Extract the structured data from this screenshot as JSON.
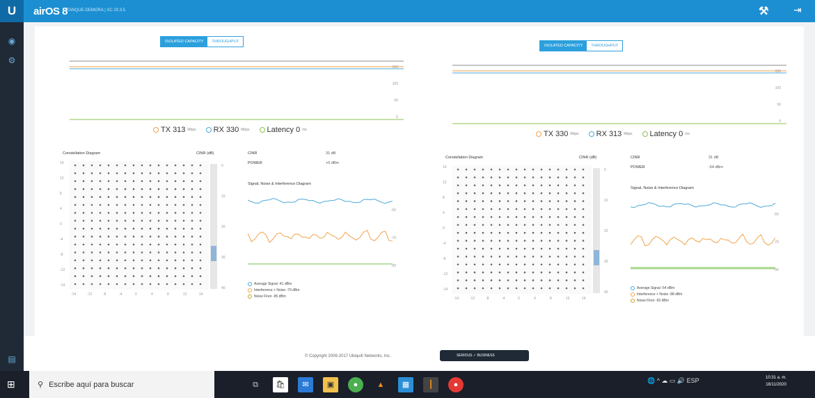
{
  "topbar": {
    "logo": "U",
    "product": "airOS 8",
    "device": "TANQUE-DEMORA | XC 20.3.5",
    "tool_icon": "antenna-tools-icon",
    "logout_icon": "logout-icon"
  },
  "sidebar": {
    "items": [
      {
        "name": "dashboard",
        "icon": "gauge-icon"
      },
      {
        "name": "settings",
        "icon": "gear-icon"
      },
      {
        "name": "logs",
        "icon": "log-icon"
      }
    ]
  },
  "panels": [
    {
      "tabs": [
        "ISOLATED CAPACITY",
        "THROUGHPUT"
      ],
      "active_tab": 0,
      "throughput_axis_right": [
        "200",
        "100",
        "50",
        "0"
      ],
      "legend": {
        "tx_label": "TX",
        "tx_value": "313",
        "tx_unit": "Mbps",
        "rx_label": "RX",
        "rx_value": "330",
        "rx_unit": "Mbps",
        "lat_label": "Latency",
        "lat_value": "0",
        "lat_unit": "ms"
      },
      "constellation_title": "Constellation Diagram",
      "cinr_label": "CINR (dB)",
      "y_ticks": [
        "14",
        "12",
        "8",
        "4",
        "0",
        "-4",
        "-8",
        "-12",
        "-14"
      ],
      "x_ticks": [
        "-14",
        "-12",
        "-8",
        "-4",
        "0",
        "4",
        "8",
        "12",
        "14"
      ],
      "scale_ticks": [
        "0",
        "10",
        "20",
        "30",
        "40"
      ],
      "stats": [
        {
          "label": "CINR",
          "value": "31 dB"
        },
        {
          "label": "POWER",
          "value": "+0 dBm"
        }
      ],
      "sni_title": "Signal, Noise & Interference Diagram",
      "sni_axis": [
        "-50",
        "-70",
        "-90"
      ],
      "sni_legend": [
        "Average Signal -41 dBm",
        "Interference + Noise -79 dBm",
        "Noise Floor -95 dBm"
      ]
    },
    {
      "tabs": [
        "ISOLATED CAPACITY",
        "THROUGHPUT"
      ],
      "active_tab": 0,
      "throughput_axis_right": [
        "200",
        "100",
        "50",
        "0"
      ],
      "legend": {
        "tx_label": "TX",
        "tx_value": "330",
        "tx_unit": "Mbps",
        "rx_label": "RX",
        "rx_value": "313",
        "rx_unit": "Mbps",
        "lat_label": "Latency",
        "lat_value": "0",
        "lat_unit": "ms"
      },
      "constellation_title": "Constellation Diagram",
      "cinr_label": "CINR (dB)",
      "y_ticks": [
        "14",
        "12",
        "8",
        "4",
        "0",
        "-4",
        "-8",
        "-12",
        "-14"
      ],
      "x_ticks": [
        "-14",
        "-12",
        "-8",
        "-4",
        "0",
        "4",
        "8",
        "12",
        "14"
      ],
      "scale_ticks": [
        "0",
        "10",
        "20",
        "30",
        "40"
      ],
      "stats": [
        {
          "label": "CINR",
          "value": "31 dB"
        },
        {
          "label": "POWER",
          "value": "-54 dBm"
        }
      ],
      "sni_title": "Signal, Noise & Interference Diagram",
      "sni_axis": [
        "-50",
        "-70",
        "-90"
      ],
      "sni_legend": [
        "Average Signal -54 dBm",
        "Interference + Noise -88 dBm",
        "Noise Floor -93 dBm"
      ]
    }
  ],
  "footer": {
    "copyright": "© Copyright 2006-2017 Ubiquiti Networks, Inc.",
    "badge": "SERIOUS ✓ BUSINESS"
  },
  "taskbar": {
    "search_placeholder": "Escribe aquí para buscar",
    "apps": [
      "task-view-icon",
      "store-icon",
      "mail-icon",
      "explorer-icon",
      "chrome-icon",
      "vlc-icon",
      "app-icon",
      "app2-icon",
      "chrome2-icon"
    ],
    "lang": "ESP",
    "time": "10:31 a. m.",
    "date": "18/11/2020"
  },
  "colors": {
    "accent": "#2ca0dd",
    "tx": "#f0a24a",
    "rx": "#4ba8d8",
    "latency": "#8bc34a",
    "topbar": "#1b8fd2",
    "sidebar": "#1f2a36"
  }
}
